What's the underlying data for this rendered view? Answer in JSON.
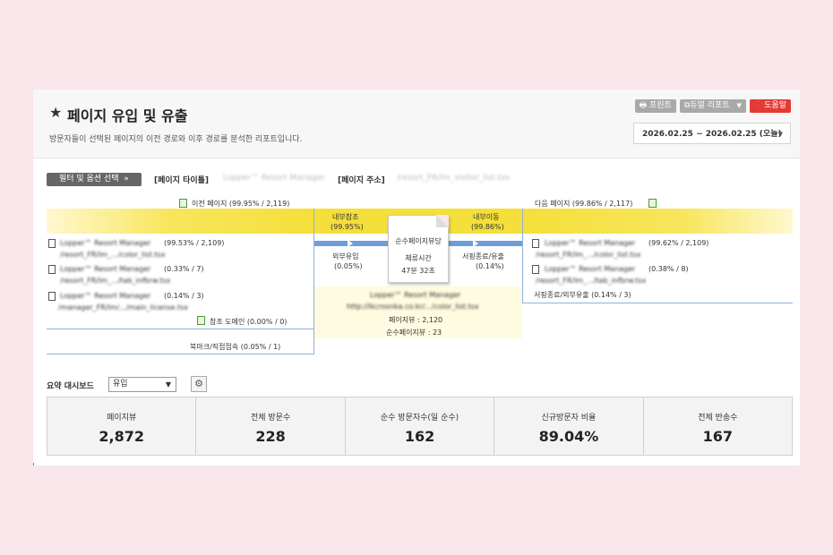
{
  "header": {
    "title": "페이지 유입 및 유출",
    "subtitle": "방문자들이 선택된 페이지의 이전 경로와 이후 경로를 분석한 리포트입니다.",
    "buttons": {
      "print": "프린트",
      "dual_report": "듀얼 리포트",
      "help": "도움말"
    },
    "date_range": "2026.02.25 ~ 2026.02.25 (오늘)"
  },
  "filter": {
    "button": "필터 및 옵션 선택",
    "page_title_label": "[페이지 타이틀]",
    "page_title_value": "Lopper™ Resort Manager",
    "page_url_label": "[페이지 주소]",
    "page_url_value": "/resort_FR/lm_visitor_list.tsx"
  },
  "flow": {
    "prev_header": "이전 페이지 (99.95% / 2,119)",
    "next_header": "다음 페이지 (99.86% / 2,117)",
    "inbound_internal": "내부참조",
    "inbound_internal_pct": "(99.95%)",
    "inbound_external": "외부유입",
    "inbound_external_pct": "(0.05%)",
    "outbound_internal": "내부이동",
    "outbound_internal_pct": "(99.86%)",
    "outbound_exit": "서핑종료/유출",
    "outbound_exit_pct": "(0.14%)",
    "center": {
      "line1": "순수페이지뷰당",
      "line2": "체류시간",
      "line3": "47분 32초",
      "page_title": "Lopper™ Resort Manager",
      "page_url": "http://lkcrosnka.co.kr/.../color_list.tsx",
      "pageviews": "페이지뷰 : 2,120",
      "unique_pageviews": "순수페이지뷰 : 23"
    },
    "prev_pages": [
      {
        "title": "Lopper™ Resort Manager",
        "stat": "(99.53% / 2,109)",
        "url": "/resort_FR/lm_.../color_list.tsx"
      },
      {
        "title": "Lopper™ Resort Manager",
        "stat": "(0.33% / 7)",
        "url": "/resort_FR/lm_.../tab_infbrw.tsx"
      },
      {
        "title": "Lopper™ Resort Manager",
        "stat": "(0.14% / 3)",
        "url": "/manager_FR/lm/.../main_license.tsx"
      }
    ],
    "referral_domain": "참조 도메인 (0.00% / 0)",
    "bookmark_direct": "북마크/직접접속 (0.05% / 1)",
    "next_pages": [
      {
        "title": "Lopper™ Resort Manager",
        "stat": "(99.62% / 2,109)",
        "url": "/resort_FR/lm_.../color_list.tsx"
      },
      {
        "title": "Lopper™ Resort Manager",
        "stat": "(0.38% / 8)",
        "url": "/resort_FR/lm_.../tab_infbrw.tsx"
      }
    ],
    "exit_line": "서핑종료/외부유출 (0.14% / 3)"
  },
  "summary": {
    "label": "요약 대시보드",
    "select_value": "유입",
    "stats": [
      {
        "label": "페이지뷰",
        "value": "2,872"
      },
      {
        "label": "전체 방문수",
        "value": "228"
      },
      {
        "label": "순수 방문자수(일 순수)",
        "value": "162"
      },
      {
        "label": "신규방문자 비율",
        "value": "89.04%"
      },
      {
        "label": "전체 반송수",
        "value": "167"
      }
    ]
  }
}
